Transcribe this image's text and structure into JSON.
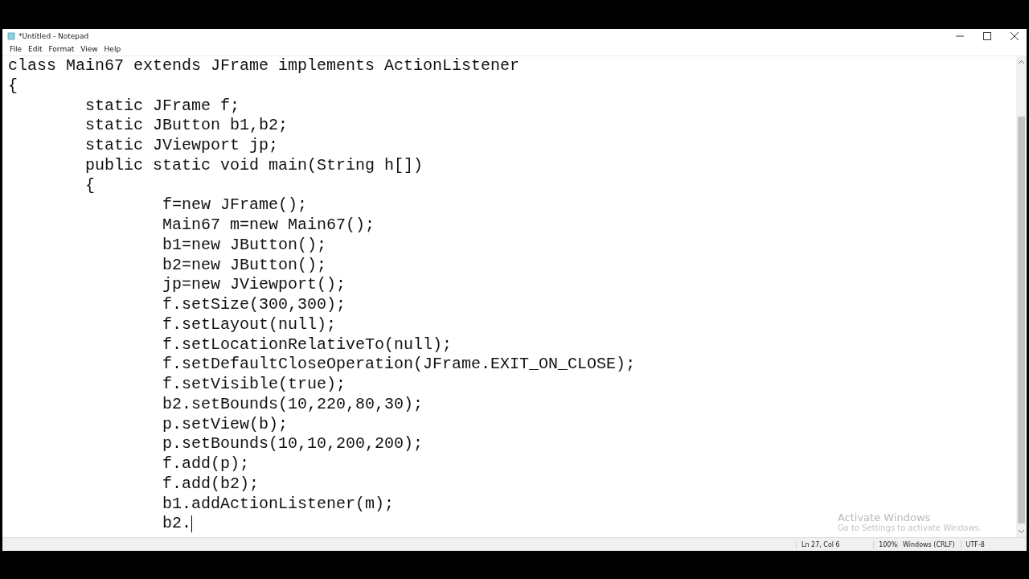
{
  "window": {
    "title": "*Untitled - Notepad"
  },
  "menu": [
    "File",
    "Edit",
    "Format",
    "View",
    "Help"
  ],
  "editor": {
    "lines": [
      "class Main67 extends JFrame implements ActionListener",
      "{",
      "\tstatic JFrame f;",
      "\tstatic JButton b1,b2;",
      "\tstatic JViewport jp;",
      "\tpublic static void main(String h[])",
      "\t{",
      "\t\tf=new JFrame();",
      "\t\tMain67 m=new Main67();",
      "\t\tb1=new JButton();",
      "\t\tb2=new JButton();",
      "\t\tjp=new JViewport();",
      "\t\tf.setSize(300,300);",
      "\t\tf.setLayout(null);",
      "\t\tf.setLocationRelativeTo(null);",
      "\t\tf.setDefaultCloseOperation(JFrame.EXIT_ON_CLOSE);",
      "\t\tf.setVisible(true);",
      "\t\tb2.setBounds(10,220,80,30);",
      "\t\tp.setView(b);",
      "\t\tp.setBounds(10,10,200,200);",
      "\t\tf.add(p);",
      "\t\tf.add(b2);",
      "\t\tb1.addActionListener(m);",
      "\t\tb2."
    ]
  },
  "activation": {
    "title": "Activate Windows",
    "hint": "Go to Settings to activate Windows."
  },
  "status_bar": [
    "Ln 27, Col 6",
    "100%",
    "Windows (CRLF)",
    "UTF-8"
  ]
}
